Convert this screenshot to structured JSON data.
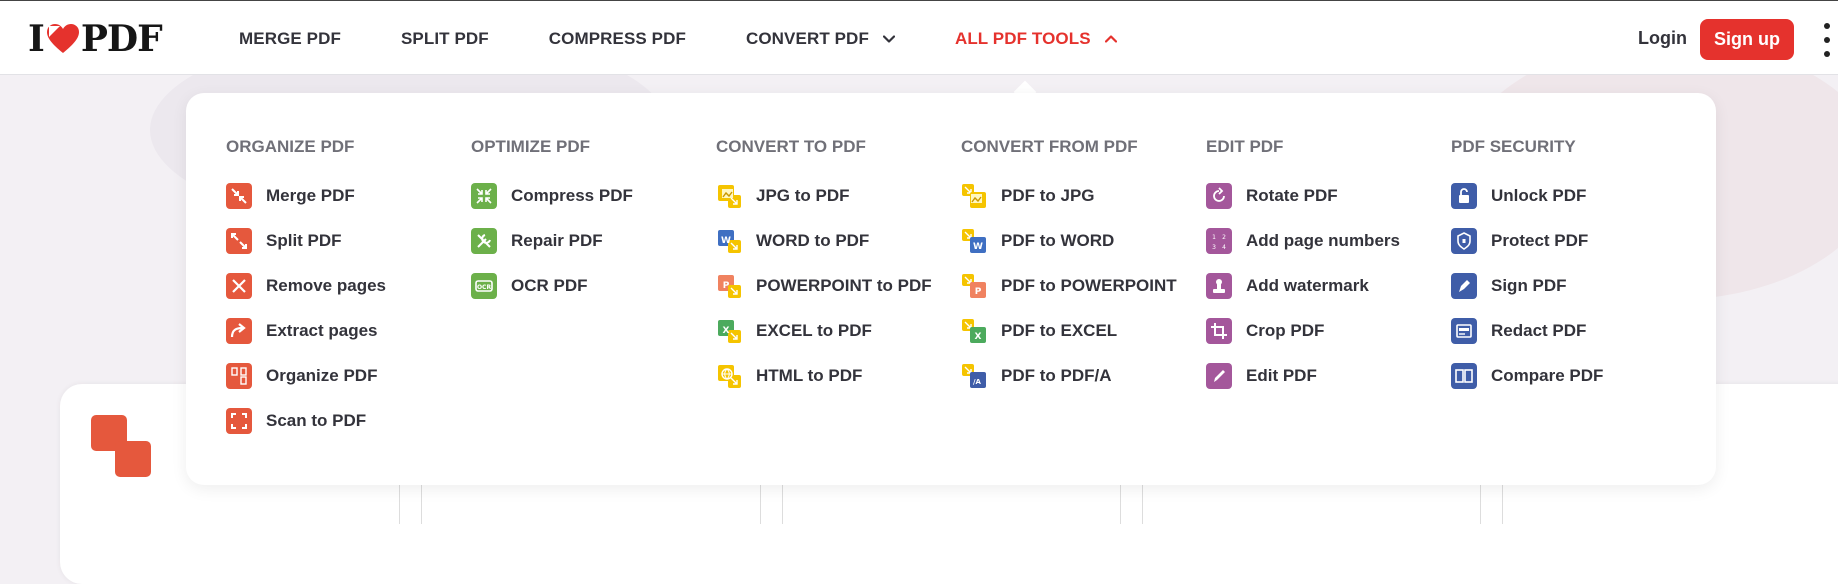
{
  "brand": {
    "logo_left": "I",
    "logo_right": "PDF",
    "red": "#e5322d"
  },
  "nav": [
    {
      "label": "MERGE PDF",
      "chevron": null,
      "active": false
    },
    {
      "label": "SPLIT PDF",
      "chevron": null,
      "active": false
    },
    {
      "label": "COMPRESS PDF",
      "chevron": null,
      "active": false
    },
    {
      "label": "CONVERT PDF",
      "chevron": "chevron-down-icon",
      "active": false
    },
    {
      "label": "ALL PDF TOOLS",
      "chevron": "chevron-up-icon",
      "active": true
    }
  ],
  "auth": {
    "login": "Login",
    "signup": "Sign up"
  },
  "menu": [
    {
      "title": "ORGANIZE PDF",
      "tools": [
        {
          "label": "Merge PDF",
          "icon": "merge-pdf-icon",
          "color": "#e5583d"
        },
        {
          "label": "Split PDF",
          "icon": "split-pdf-icon",
          "color": "#e5583d"
        },
        {
          "label": "Remove pages",
          "icon": "remove-pages-icon",
          "color": "#e5583d"
        },
        {
          "label": "Extract pages",
          "icon": "extract-pages-icon",
          "color": "#e5583d"
        },
        {
          "label": "Organize PDF",
          "icon": "organize-pdf-icon",
          "color": "#e5583d"
        },
        {
          "label": "Scan to PDF",
          "icon": "scan-to-pdf-icon",
          "color": "#e5583d"
        }
      ]
    },
    {
      "title": "OPTIMIZE PDF",
      "tools": [
        {
          "label": "Compress PDF",
          "icon": "compress-pdf-icon",
          "color": "#6cb04a"
        },
        {
          "label": "Repair PDF",
          "icon": "repair-pdf-icon",
          "color": "#6cb04a"
        },
        {
          "label": "OCR PDF",
          "icon": "ocr-pdf-icon",
          "color": "#6cb04a"
        }
      ]
    },
    {
      "title": "CONVERT TO PDF",
      "tools": [
        {
          "label": "JPG to PDF",
          "icon": "jpg-to-pdf-icon",
          "color": "#f5c400"
        },
        {
          "label": "WORD to PDF",
          "icon": "word-to-pdf-icon",
          "color": "#3f6fc2"
        },
        {
          "label": "POWERPOINT to PDF",
          "icon": "powerpoint-to-pdf-icon",
          "color": "#f08260"
        },
        {
          "label": "EXCEL to PDF",
          "icon": "excel-to-pdf-icon",
          "color": "#4caa5d"
        },
        {
          "label": "HTML to PDF",
          "icon": "html-to-pdf-icon",
          "color": "#f5c400"
        }
      ]
    },
    {
      "title": "CONVERT FROM PDF",
      "tools": [
        {
          "label": "PDF to JPG",
          "icon": "pdf-to-jpg-icon",
          "color": "#f5c400"
        },
        {
          "label": "PDF to WORD",
          "icon": "pdf-to-word-icon",
          "color": "#3f6fc2"
        },
        {
          "label": "PDF to POWERPOINT",
          "icon": "pdf-to-powerpoint-icon",
          "color": "#f08260"
        },
        {
          "label": "PDF to EXCEL",
          "icon": "pdf-to-excel-icon",
          "color": "#4caa5d"
        },
        {
          "label": "PDF to PDF/A",
          "icon": "pdf-to-pdfa-icon",
          "color": "#3f5da8"
        }
      ]
    },
    {
      "title": "EDIT PDF",
      "tools": [
        {
          "label": "Rotate PDF",
          "icon": "rotate-pdf-icon",
          "color": "#a4579b"
        },
        {
          "label": "Add page numbers",
          "icon": "page-numbers-icon",
          "color": "#a4579b"
        },
        {
          "label": "Add watermark",
          "icon": "watermark-icon",
          "color": "#a4579b"
        },
        {
          "label": "Crop PDF",
          "icon": "crop-pdf-icon",
          "color": "#a4579b"
        },
        {
          "label": "Edit PDF",
          "icon": "edit-pdf-icon",
          "color": "#a4579b"
        }
      ]
    },
    {
      "title": "PDF SECURITY",
      "tools": [
        {
          "label": "Unlock PDF",
          "icon": "unlock-pdf-icon",
          "color": "#3f5da8"
        },
        {
          "label": "Protect PDF",
          "icon": "protect-pdf-icon",
          "color": "#3f5da8"
        },
        {
          "label": "Sign PDF",
          "icon": "sign-pdf-icon",
          "color": "#3f5da8"
        },
        {
          "label": "Redact PDF",
          "icon": "redact-pdf-icon",
          "color": "#3f5da8"
        },
        {
          "label": "Compare PDF",
          "icon": "compare-pdf-icon",
          "color": "#3f5da8"
        }
      ]
    }
  ]
}
